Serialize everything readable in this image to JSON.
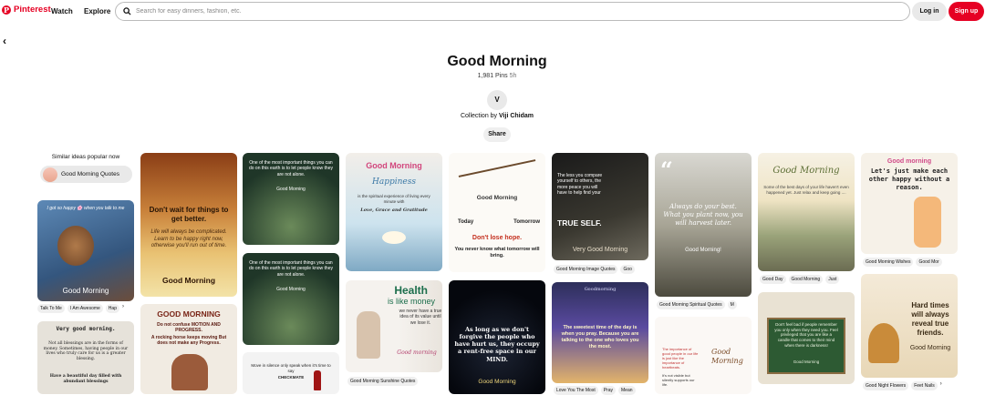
{
  "header": {
    "brand": "Pinterest",
    "nav_watch": "Watch",
    "nav_explore": "Explore",
    "search_placeholder": "Search for easy dinners, fashion, etc.",
    "login": "Log in",
    "signup": "Sign up"
  },
  "board": {
    "title": "Good Morning",
    "pins": "1,981 Pins",
    "age": "5h",
    "avatar_initial": "V",
    "collection_prefix": "Collection by",
    "owner": "Viji Chidam",
    "share": "Share"
  },
  "similar": {
    "heading": "Similar ideas popular now",
    "chip": "Good Morning Quotes"
  },
  "pins": {
    "p1": "I got so happy 🌸 when you talk to me",
    "p1b": "Good Morning",
    "p1tags": [
      "Talk To Me",
      "I Am Awesome",
      "Hap"
    ],
    "p2": "Very good morning.",
    "p2b": "Not all blessings are in the forms of money. Sometimes, having people in our lives who truly care for us is a greater blessing.",
    "p2c": "Have a beautiful day filled with abundant blessings",
    "p3": "Don't wait for things to get better.",
    "p3b": "Life will always be complicated. Learn to be happy right now, otherwise you'll run out of time.",
    "p3c": "Good Morning",
    "p4": "GOOD MORNING",
    "p4b": "Do not confuse MOTION AND PROGRESS.",
    "p4c": "A rocking horse keeps moving But does not make any Progress.",
    "p5": "One of the most important things you can do on this earth is to let people know they are not alone.",
    "p5b": "Good Morning",
    "p6": "One of the most important things you can do on this earth is to let people know they are not alone.",
    "p6b": "Good Morning",
    "p7": "Move in silence only speak when it's time to say",
    "p7b": "CHECKMATE",
    "p8": "Good Morning",
    "p8b": "Happiness",
    "p8c": "is the spiritual experience of living every minute with",
    "p8d": "Love, Grace and Gratitude",
    "p9": "Health",
    "p9b": "is like money",
    "p9c": "we never have a true idea of its value until we lose it.",
    "p9d": "Good morning",
    "p9tags": [
      "Good Morning Sunshine Quotes"
    ],
    "p10": "Good Morning",
    "p10b": "Today",
    "p10c": "Tomorrow",
    "p10d": "Don't lose hope.",
    "p10e": "You never know what tomorrow will bring.",
    "p11": "As long as we don't forgive the people who have hurt us, they occupy a rent-free space in our MIND.",
    "p11b": "Good Morning",
    "p12": "The less you compare yourself to others, the more peace you will have to help find your",
    "p12b": "TRUE SELF.",
    "p12c": "Very Good Morning",
    "p12tags": [
      "Good Morning Image Quotes",
      "Goo"
    ],
    "p13": "Goodmorning",
    "p13b": "The sweetest time of the day is when you pray. Because you are talking to the one who loves you the most.",
    "p13tags": [
      "Love You The Most",
      "Pray",
      "Mean"
    ],
    "p14": "Always do your best. What you plant now, you will harvest later.",
    "p14b": "Good Morning!",
    "p14tags": [
      "Good Morning Spiritual Quotes",
      "M"
    ],
    "p15": "The importance of good people in our life is just like the importance of heartbeats.",
    "p15b": "Good Morning",
    "p15c": "It's not visible but silently supports our life.",
    "p16": "Good Morning",
    "p16b": "Some of the best days of your life haven't even happened yet. Just relax and keep going ....",
    "p16tags": [
      "Good Day",
      "Good Morning",
      "Just"
    ],
    "p17": "Don't feel bad if people remember you only when they need you. Feel privileged that you are like a candle that comes to their mind when there is darkness!",
    "p17b": "Good Morning",
    "p18": "Good morning",
    "p18b": "Let's just make each other happy without a reason.",
    "p18tags": [
      "Good Morning Wishes",
      "Good Mor"
    ],
    "p19": "Hard times will always reveal true friends.",
    "p19b": "Good Morning",
    "p19tags": [
      "Good Night Flowers",
      "Feet Nails"
    ]
  },
  "colors": {
    "brand": "#e60023"
  }
}
